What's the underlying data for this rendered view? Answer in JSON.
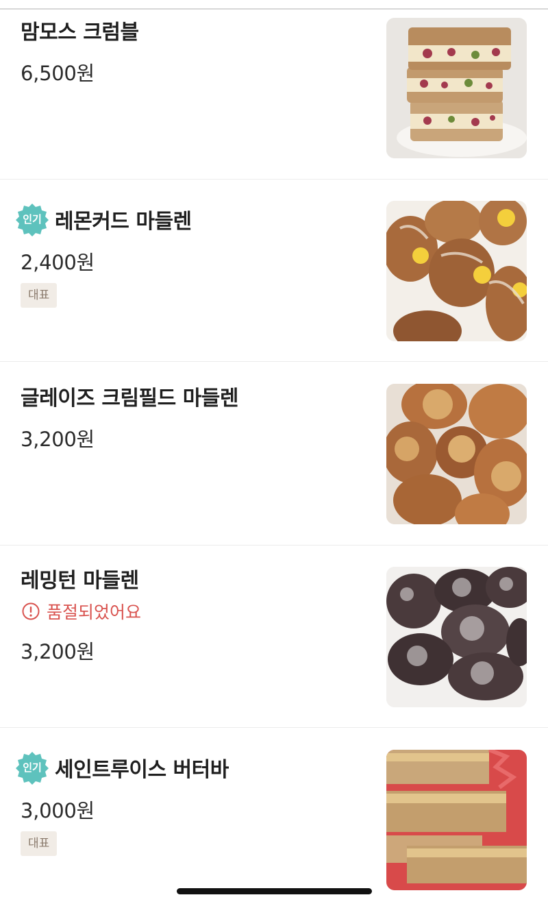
{
  "menu_items": [
    {
      "name": "맘모스 크럼블",
      "price": "6,500원",
      "popular": false,
      "tag": "",
      "soldout_text": "",
      "image_icon": "crumble-cake-photo"
    },
    {
      "name": "레몬커드 마들렌",
      "price": "2,400원",
      "popular": true,
      "tag": "대표",
      "soldout_text": "",
      "image_icon": "lemon-curd-madeleine-photo"
    },
    {
      "name": "글레이즈 크림필드 마들렌",
      "price": "3,200원",
      "popular": false,
      "tag": "",
      "soldout_text": "",
      "image_icon": "glazed-cream-madeleine-photo"
    },
    {
      "name": "레밍턴 마들렌",
      "price": "3,200원",
      "popular": false,
      "tag": "",
      "soldout_text": "품절되었어요",
      "image_icon": "lamington-madeleine-photo"
    },
    {
      "name": "세인트루이스 버터바",
      "price": "3,000원",
      "popular": true,
      "tag": "대표",
      "soldout_text": "",
      "image_icon": "butter-bar-photo"
    }
  ],
  "badges": {
    "popular_label": "인기"
  },
  "colors": {
    "popular_badge": "#5ec2bd",
    "soldout": "#d9534f",
    "tag_bg": "#f1ece6",
    "tag_text": "#8a7a6c"
  }
}
